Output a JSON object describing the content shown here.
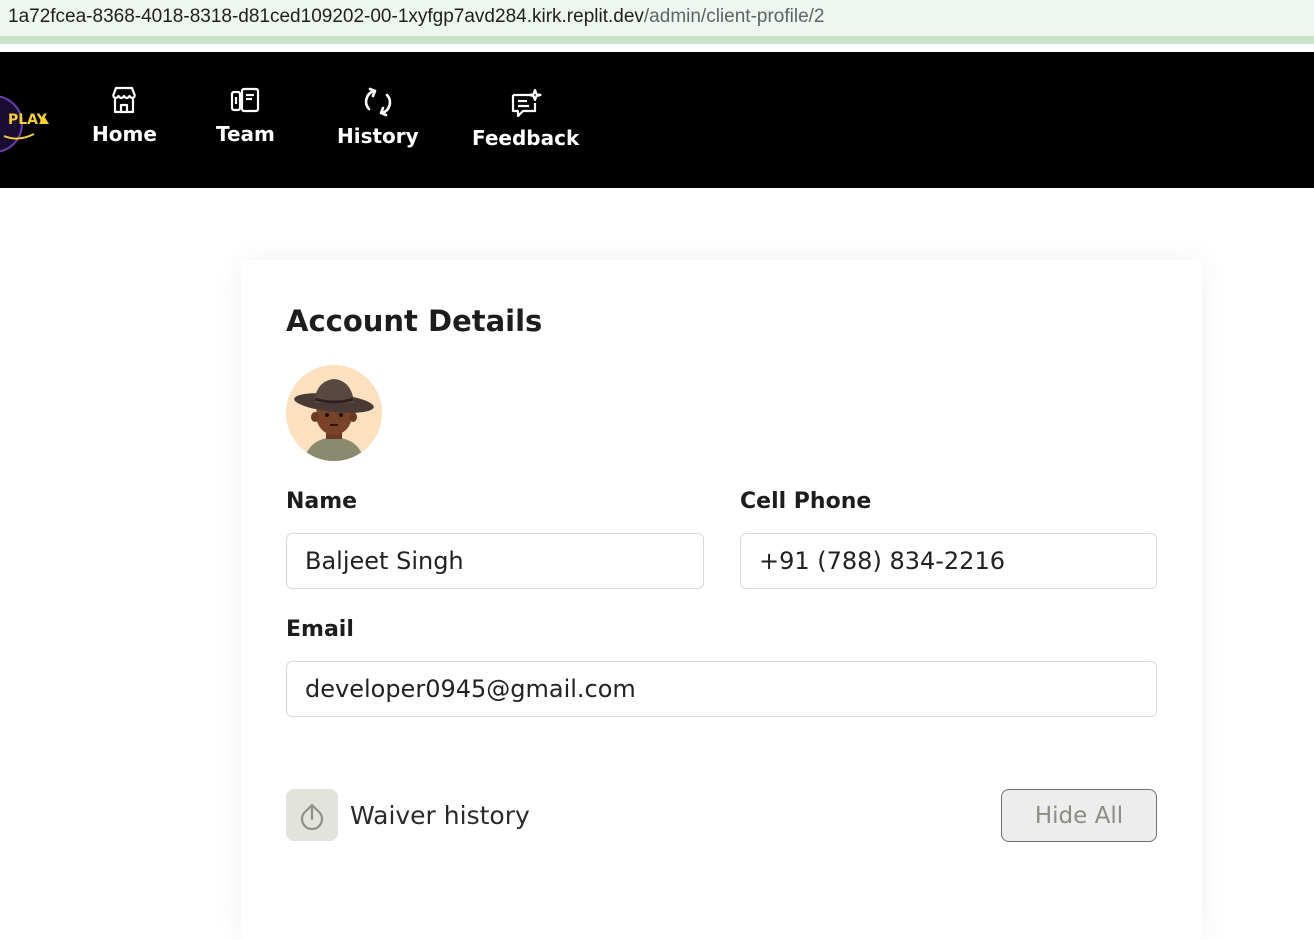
{
  "browser": {
    "url_host": "1a72fcea-8368-4018-8318-d81ced109202-00-1xyfgp7avd284.kirk.replit.dev",
    "url_path": "/admin/client-profile/2"
  },
  "nav": {
    "logo_text": "PLAY",
    "items": [
      {
        "label": "Home",
        "icon": "store-icon"
      },
      {
        "label": "Team",
        "icon": "team-icon"
      },
      {
        "label": "History",
        "icon": "refresh-icon"
      },
      {
        "label": "Feedback",
        "icon": "feedback-icon"
      }
    ]
  },
  "account": {
    "title": "Account Details",
    "name_label": "Name",
    "name_value": "Baljeet Singh",
    "phone_label": "Cell Phone",
    "phone_value": "+91 (788) 834-2216",
    "email_label": "Email",
    "email_value": "developer0945@gmail.com",
    "waiver_label": "Waiver history",
    "hide_all_label": "Hide All"
  },
  "colors": {
    "nav_bg": "#000000",
    "logo_accent": "#f5d033",
    "avatar_bg": "#fde0bd",
    "waiver_btn_bg": "#e2e3dc"
  }
}
